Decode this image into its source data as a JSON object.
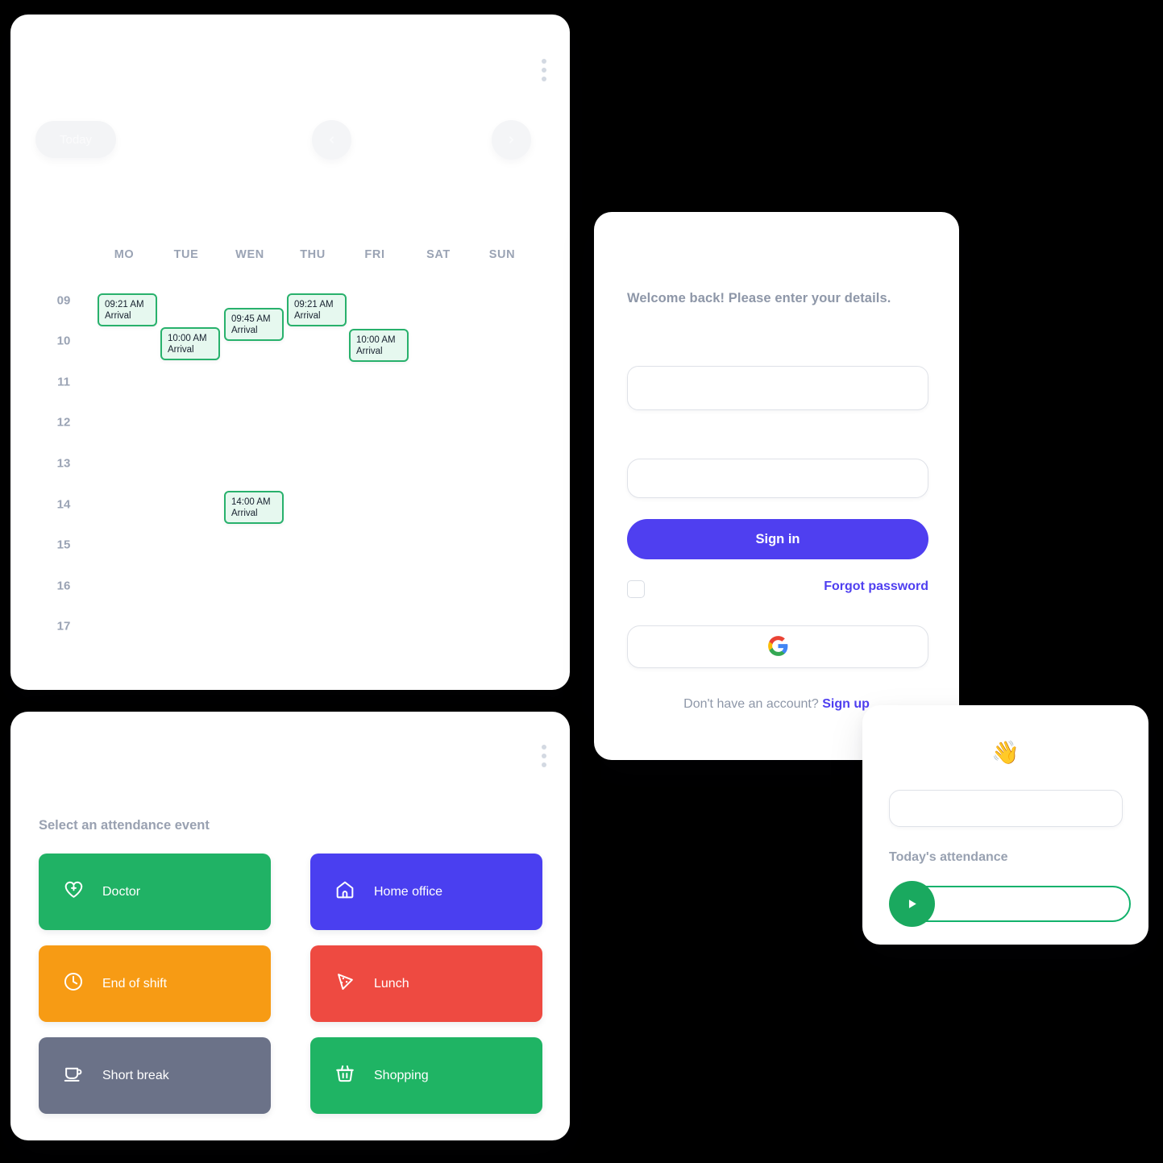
{
  "calendar": {
    "menu_icon": "kebab-menu-icon",
    "today_label": "Today",
    "prev_icon": "chevron-left-icon",
    "next_icon": "chevron-right-icon",
    "days": [
      "MO",
      "TUE",
      "WEN",
      "THU",
      "FRI",
      "SAT",
      "SUN"
    ],
    "hours": [
      "09",
      "10",
      "11",
      "12",
      "13",
      "14",
      "15",
      "16",
      "17"
    ],
    "event_fill": "#e6f8ef",
    "event_border": "#28b16c",
    "events": [
      {
        "day": "MO",
        "time": "09:21 AM",
        "label": "Arrival"
      },
      {
        "day": "TUE",
        "time": "10:00 AM",
        "label": "Arrival"
      },
      {
        "day": "WEN",
        "time": "09:45 AM",
        "label": "Arrival"
      },
      {
        "day": "THU",
        "time": "09:21 AM",
        "label": "Arrival"
      },
      {
        "day": "FRI",
        "time": "10:00 AM",
        "label": "Arrival"
      },
      {
        "day": "WEN",
        "time": "14:00 AM",
        "label": "Arrival"
      }
    ]
  },
  "signin": {
    "welcome": "Welcome back! Please enter your details.",
    "email_value": "",
    "email_placeholder": "",
    "password_value": "",
    "password_placeholder": "",
    "signin_label": "Sign in",
    "remember_checked": false,
    "forgot_label": "Forgot password",
    "google_icon": "google-g-icon",
    "signup_prefix": "Don't have an account? ",
    "signup_label": "Sign up",
    "accent_color": "#4f3ff0"
  },
  "events_panel": {
    "menu_icon": "kebab-menu-icon",
    "title": "Select an attendance event",
    "items": [
      {
        "label": "Doctor",
        "icon": "heart-plus-icon",
        "color": "#20b265"
      },
      {
        "label": "Home office",
        "icon": "home-icon",
        "color": "#4a3ff0"
      },
      {
        "label": "End of shift",
        "icon": "clock-icon",
        "color": "#f79b14"
      },
      {
        "label": "Lunch",
        "icon": "pizza-slice-icon",
        "color": "#ee4a41"
      },
      {
        "label": "Short break",
        "icon": "coffee-cup-icon",
        "color": "#6b7288"
      },
      {
        "label": "Shopping",
        "icon": "shopping-basket-icon",
        "color": "#1fb464"
      }
    ]
  },
  "widget": {
    "wave_emoji": "👋",
    "input_value": "",
    "input_placeholder": "",
    "label": "Today's attendance",
    "play_icon": "play-icon",
    "pill_color": "#12b26c",
    "play_color": "#1aa95f"
  }
}
